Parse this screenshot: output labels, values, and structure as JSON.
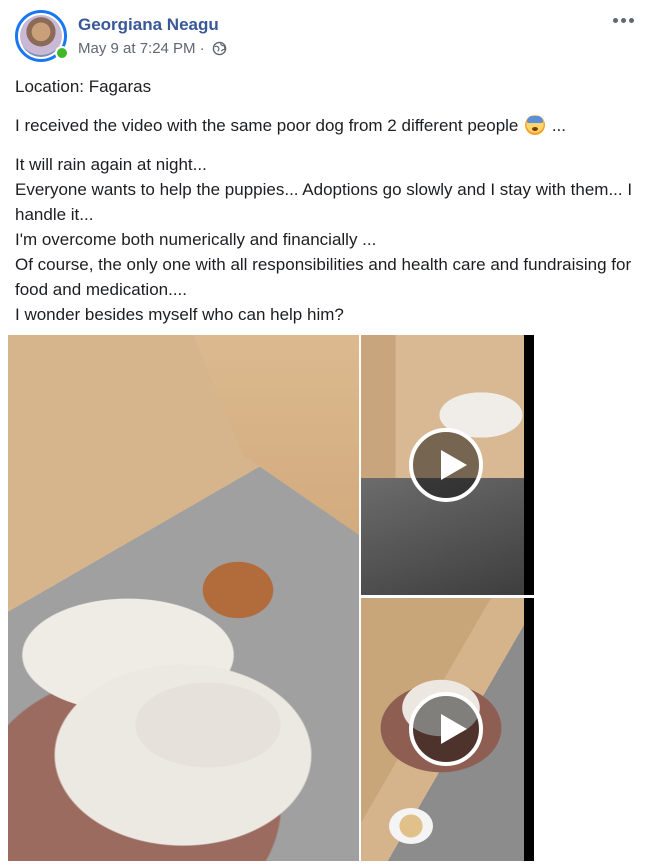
{
  "post": {
    "author": "Georgiana Neagu",
    "date": "May 9 at 7:24 PM",
    "separator": "·",
    "privacy_icon": "globe-icon",
    "more_icon": "more-options-icon",
    "online_color": "#42b72a",
    "accent_color": "#1877f2",
    "author_color": "#385898"
  },
  "text": {
    "location": "Location: Fagaras",
    "line1_before": "I received the video with the same poor dog from 2 different people ",
    "line1_emoji": "anxious-face-emoji",
    "line1_after": " ...",
    "line2": "It will rain again at night...",
    "line3": "Everyone wants to help the puppies... Adoptions go slowly and I stay with them... I handle it...",
    "line4": "I'm overcome both numerically and financially ...",
    "line5": "Of course, the only one with all responsibilities and health care and fundraising for food and medication....",
    "line6": "I wonder besides myself who can help him?"
  },
  "media": {
    "main_photo": "dog-photo",
    "videos": [
      "video-thumbnail-1",
      "video-thumbnail-2"
    ],
    "play_icon": "play-icon"
  }
}
